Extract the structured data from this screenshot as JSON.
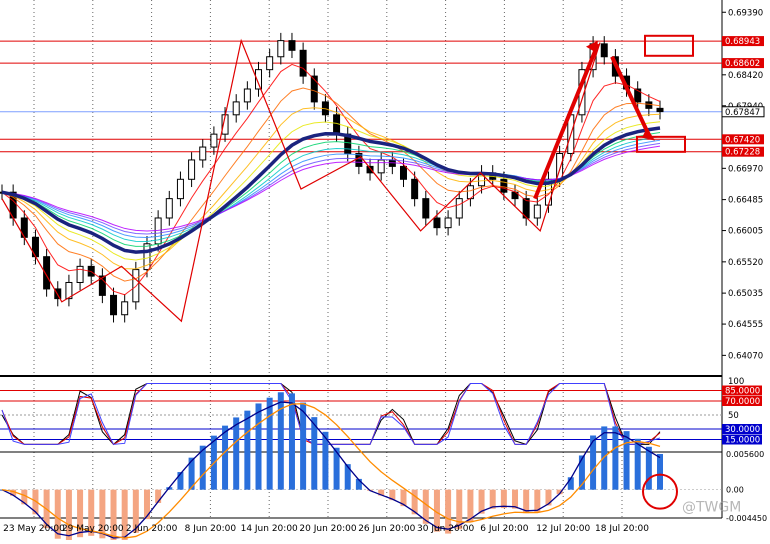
{
  "chart_data": [
    {
      "type": "candlestick",
      "panel": "price",
      "y_range": [
        0.6375,
        0.6958
      ],
      "y_ticks": [
        "0.69390",
        "0.68943",
        "0.68602",
        "0.68420",
        "0.67940",
        "0.67847",
        "0.67420",
        "0.67228",
        "0.66970",
        "0.66485",
        "0.66005",
        "0.65520",
        "0.65035",
        "0.64555",
        "0.64070"
      ],
      "price_levels": [
        {
          "label": "0.68943",
          "value": 0.68943,
          "color": "#e00000"
        },
        {
          "label": "0.68602",
          "value": 0.68602,
          "color": "#e00000"
        },
        {
          "label": "0.67847",
          "value": 0.67847,
          "color": "#e00000"
        },
        {
          "label": "0.67420",
          "value": 0.6742,
          "color": "#e00000"
        },
        {
          "label": "0.67228",
          "value": 0.67228,
          "color": "#e00000"
        }
      ],
      "zigzag": [
        {
          "date": "22 May",
          "value": 0.665
        },
        {
          "date": "26 May",
          "value": 0.649
        },
        {
          "date": "28 May",
          "value": 0.6545
        },
        {
          "date": "30 May",
          "value": 0.646
        },
        {
          "date": "14 Jun",
          "value": 0.6895
        },
        {
          "date": "20 Jun",
          "value": 0.6665
        },
        {
          "date": "25 Jun",
          "value": 0.6715
        },
        {
          "date": "28 Jun",
          "value": 0.66
        },
        {
          "date": "3 Jul",
          "value": 0.669
        },
        {
          "date": "6 Jul",
          "value": 0.66
        },
        {
          "date": "12 Jul",
          "value": 0.6892
        }
      ],
      "close_series": [
        0.666,
        0.662,
        0.659,
        0.656,
        0.651,
        0.6495,
        0.652,
        0.6545,
        0.653,
        0.65,
        0.647,
        0.649,
        0.654,
        0.658,
        0.662,
        0.665,
        0.668,
        0.671,
        0.673,
        0.675,
        0.678,
        0.68,
        0.682,
        0.685,
        0.687,
        0.6895,
        0.688,
        0.684,
        0.68,
        0.678,
        0.675,
        0.672,
        0.67,
        0.669,
        0.671,
        0.67,
        0.668,
        0.665,
        0.662,
        0.6605,
        0.662,
        0.665,
        0.667,
        0.669,
        0.668,
        0.666,
        0.665,
        0.662,
        0.664,
        0.668,
        0.672,
        0.678,
        0.685,
        0.689,
        0.687,
        0.684,
        0.682,
        0.68,
        0.679,
        0.6785
      ],
      "annotations": [
        {
          "kind": "rect",
          "near_value": 0.6885,
          "label": ""
        },
        {
          "kind": "rect",
          "near_value": 0.673,
          "label": ""
        },
        {
          "kind": "arrow",
          "from": "6 Jul",
          "to": "12 Jul",
          "direction": "up"
        },
        {
          "kind": "arrow",
          "from": "14 Jul",
          "to": "17 Jul",
          "direction": "down"
        }
      ]
    },
    {
      "type": "line",
      "panel": "oscillator",
      "y_range": [
        0,
        100
      ],
      "levels": [
        {
          "label": "85.0000",
          "value": 85,
          "color": "#e00000"
        },
        {
          "label": "70.0000",
          "value": 70,
          "color": "#e00000"
        },
        {
          "label": "50",
          "value": 50,
          "color": "#999999"
        },
        {
          "label": "30.0000",
          "value": 30,
          "color": "#0000cc"
        },
        {
          "label": "15.0000",
          "value": 15,
          "color": "#0000cc"
        }
      ],
      "axis_top_label": "100"
    },
    {
      "type": "histogram",
      "panel": "macd",
      "y_ticks": [
        "0.005600",
        "0.00",
        "-0.004450"
      ],
      "marker": "circle"
    }
  ],
  "x_axis": {
    "labels": [
      "23 May 20:00",
      "29 May 20:00",
      "2 Jun 20:00",
      "8 Jun 20:00",
      "14 Jun 20:00",
      "20 Jun 20:00",
      "26 Jun 20:00",
      "30 Jun 20:00",
      "6 Jul 20:00",
      "12 Jul 20:00",
      "18 Jul 20:00"
    ]
  },
  "watermark": "@TWGM"
}
